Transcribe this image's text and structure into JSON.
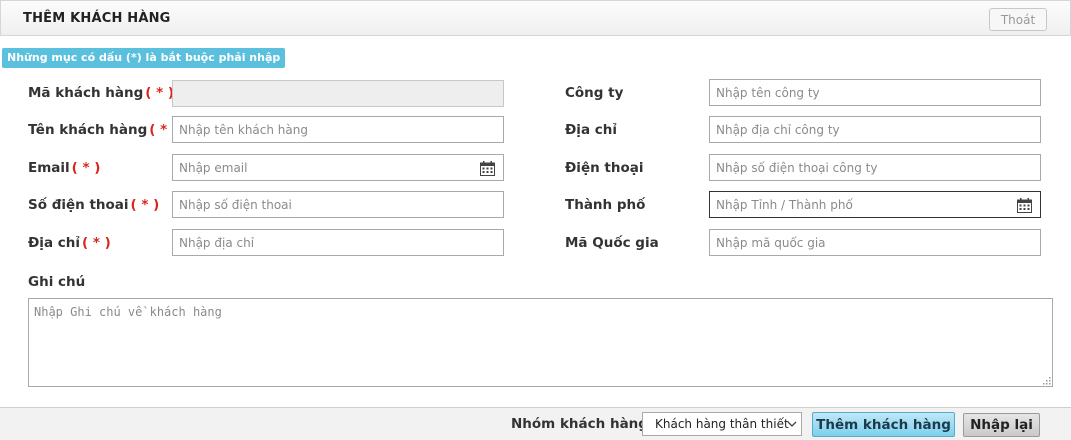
{
  "header": {
    "title": "THÊM KHÁCH HÀNG",
    "exit_label": "Thoát"
  },
  "required_note": "Những mục có dấu (*) là bắt buộc phải nhập",
  "required_marker": "( * )",
  "left": {
    "customer_code": {
      "label": "Mã khách hàng",
      "value": "",
      "placeholder": ""
    },
    "customer_name": {
      "label": "Tên khách hàng",
      "placeholder": "Nhập tên khách hàng"
    },
    "email": {
      "label": "Email",
      "placeholder": "Nhập email"
    },
    "phone": {
      "label": "Số điện thoai",
      "placeholder": "Nhập số điện thoai"
    },
    "address": {
      "label": "Địa chỉ",
      "placeholder": "Nhập địa chỉ"
    }
  },
  "right": {
    "company": {
      "label": "Công ty",
      "placeholder": "Nhập tên công ty"
    },
    "company_address": {
      "label": "Địa chỉ",
      "placeholder": "Nhập địa chỉ công ty"
    },
    "company_phone": {
      "label": "Điện thoại",
      "placeholder": "Nhập số điện thoại công ty"
    },
    "city": {
      "label": "Thành phố",
      "placeholder": "Nhập Tỉnh / Thành phố"
    },
    "country_code": {
      "label": "Mã Quốc gia",
      "placeholder": "Nhập mã quốc gia"
    }
  },
  "note": {
    "label": "Ghi chú",
    "placeholder": "Nhập Ghi chú về khách hàng"
  },
  "footer": {
    "group_label": "Nhóm khách hàng:",
    "group_selected": "Khách hàng thân thiết",
    "add_button": "Thêm khách hàng",
    "reset_button": "Nhập lại"
  }
}
